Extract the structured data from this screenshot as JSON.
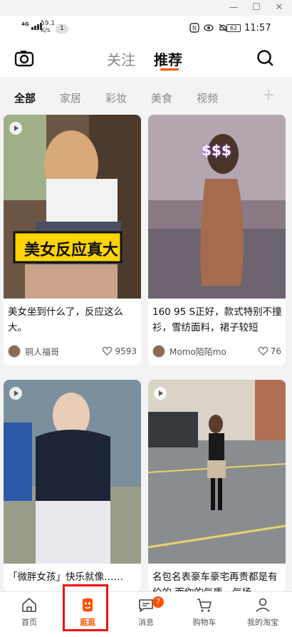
{
  "status_bar": {
    "network": "4G",
    "speed": "59.1",
    "speed_unit": "K/s",
    "notification_count": "1",
    "battery": "62",
    "time": "11:57"
  },
  "header": {
    "tabs": [
      {
        "label": "关注",
        "active": false
      },
      {
        "label": "推荐",
        "active": true
      }
    ],
    "camera_icon": "camera-icon",
    "search_icon": "search-icon"
  },
  "categories": [
    {
      "label": "全部",
      "active": true
    },
    {
      "label": "家居",
      "active": false
    },
    {
      "label": "彩妆",
      "active": false
    },
    {
      "label": "美食",
      "active": false
    },
    {
      "label": "视频",
      "active": false
    }
  ],
  "add_category_label": "+",
  "feed": [
    {
      "title": "美女坐到什么了，反应这么大。",
      "overlay_text": "美女反应真大",
      "author": "铜人福哥",
      "likes": "9593",
      "is_video": true
    },
    {
      "title": "160 95 S正好，款式特别不撞衫，雪纺面料，裙子较短",
      "overlay_text": "$$$",
      "author": "Momo陌陌mo",
      "likes": "76",
      "is_video": false
    },
    {
      "title": "「微胖女孩」快乐就像……",
      "author": "",
      "likes": "",
      "is_video": true
    },
    {
      "title": "名包名表豪车豪宅再贵都是有价的 而你的气质，气场",
      "author": "",
      "likes": "",
      "is_video": true
    }
  ],
  "bottom_nav": [
    {
      "label": "首页",
      "icon": "home-icon",
      "active": false
    },
    {
      "label": "逛逛",
      "icon": "guangguang-icon",
      "active": true
    },
    {
      "label": "消息",
      "icon": "message-icon",
      "active": false,
      "badge": "7"
    },
    {
      "label": "购物车",
      "icon": "cart-icon",
      "active": false
    },
    {
      "label": "我的淘宝",
      "icon": "profile-icon",
      "active": false
    }
  ],
  "colors": {
    "accent": "#ff5000",
    "highlight_box": "#e11111"
  }
}
